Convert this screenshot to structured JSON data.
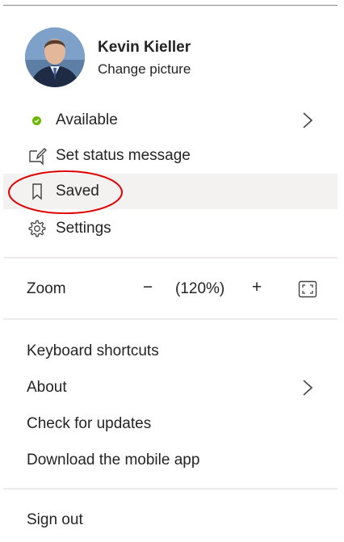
{
  "profile": {
    "name": "Kevin Kieller",
    "change_picture": "Change picture"
  },
  "status": {
    "label": "Available",
    "color": "#6bb700"
  },
  "menu": {
    "set_status": "Set status message",
    "saved": "Saved",
    "settings": "Settings"
  },
  "zoom": {
    "label": "Zoom",
    "minus": "−",
    "level": "(120%)",
    "plus": "+"
  },
  "links": {
    "keyboard_shortcuts": "Keyboard shortcuts",
    "about": "About",
    "check_updates": "Check for updates",
    "download_mobile": "Download the mobile app",
    "sign_out": "Sign out"
  },
  "icons": {
    "status": "check-circle-icon",
    "set_status": "edit-icon",
    "saved": "bookmark-icon",
    "settings": "gear-icon",
    "chevron": "chevron-right-icon",
    "fullscreen": "fullscreen-icon"
  },
  "colors": {
    "annotation": "#e00000",
    "divider": "#edebe9",
    "highlight": "#f3f2f1"
  }
}
